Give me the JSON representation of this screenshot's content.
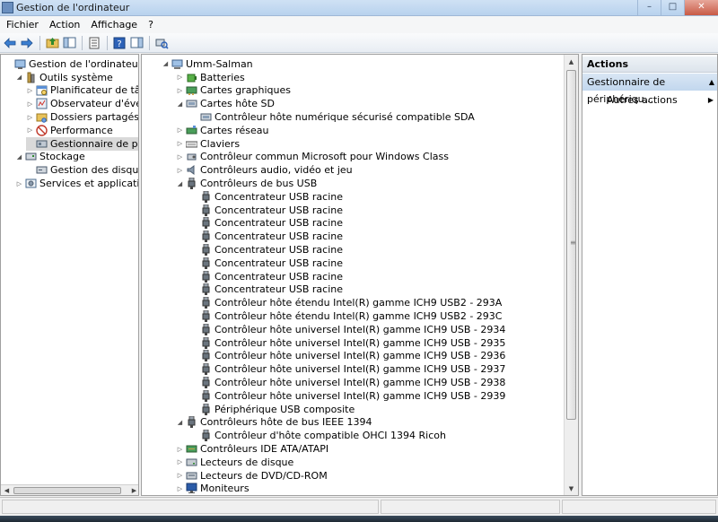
{
  "window": {
    "title": "Gestion de l'ordinateur"
  },
  "menubar": {
    "items": [
      "Fichier",
      "Action",
      "Affichage",
      "?"
    ]
  },
  "left_tree": [
    {
      "label": "Gestion de l'ordinateur (local)",
      "level": 0,
      "expander": "",
      "icon": "computer-management-icon"
    },
    {
      "label": "Outils système",
      "level": 1,
      "expander": "open",
      "icon": "tools-icon"
    },
    {
      "label": "Planificateur de tâches",
      "level": 2,
      "expander": "closed",
      "icon": "task-scheduler-icon"
    },
    {
      "label": "Observateur d'événements",
      "level": 2,
      "expander": "closed",
      "icon": "event-viewer-icon"
    },
    {
      "label": "Dossiers partagés",
      "level": 2,
      "expander": "closed",
      "icon": "shared-folder-icon"
    },
    {
      "label": "Performance",
      "level": 2,
      "expander": "closed",
      "icon": "performance-icon"
    },
    {
      "label": "Gestionnaire de périphériques",
      "level": 2,
      "expander": "",
      "icon": "device-manager-icon",
      "selected": true
    },
    {
      "label": "Stockage",
      "level": 1,
      "expander": "open",
      "icon": "storage-icon"
    },
    {
      "label": "Gestion des disques",
      "level": 2,
      "expander": "",
      "icon": "disk-management-icon"
    },
    {
      "label": "Services et applications",
      "level": 1,
      "expander": "closed",
      "icon": "services-icon"
    }
  ],
  "device_tree": [
    {
      "label": "Umm-Salman",
      "level": 0,
      "expander": "open",
      "icon": "computer-icon"
    },
    {
      "label": "Batteries",
      "level": 1,
      "expander": "closed",
      "icon": "battery-icon"
    },
    {
      "label": "Cartes graphiques",
      "level": 1,
      "expander": "closed",
      "icon": "display-adapter-icon"
    },
    {
      "label": "Cartes hôte SD",
      "level": 1,
      "expander": "open",
      "icon": "sd-host-icon"
    },
    {
      "label": "Contrôleur hôte numérique sécurisé compatible SDA",
      "level": 2,
      "expander": "",
      "icon": "sd-host-icon"
    },
    {
      "label": "Cartes réseau",
      "level": 1,
      "expander": "closed",
      "icon": "network-adapter-icon"
    },
    {
      "label": "Claviers",
      "level": 1,
      "expander": "closed",
      "icon": "keyboard-icon"
    },
    {
      "label": "Contrôleur commun Microsoft pour Windows Class",
      "level": 1,
      "expander": "closed",
      "icon": "controller-icon"
    },
    {
      "label": "Contrôleurs audio, vidéo et jeu",
      "level": 1,
      "expander": "closed",
      "icon": "audio-icon"
    },
    {
      "label": "Contrôleurs de bus USB",
      "level": 1,
      "expander": "open",
      "icon": "usb-icon"
    },
    {
      "label": "Concentrateur USB racine",
      "level": 2,
      "expander": "",
      "icon": "usb-icon"
    },
    {
      "label": "Concentrateur USB racine",
      "level": 2,
      "expander": "",
      "icon": "usb-icon"
    },
    {
      "label": "Concentrateur USB racine",
      "level": 2,
      "expander": "",
      "icon": "usb-icon"
    },
    {
      "label": "Concentrateur USB racine",
      "level": 2,
      "expander": "",
      "icon": "usb-icon"
    },
    {
      "label": "Concentrateur USB racine",
      "level": 2,
      "expander": "",
      "icon": "usb-icon"
    },
    {
      "label": "Concentrateur USB racine",
      "level": 2,
      "expander": "",
      "icon": "usb-icon"
    },
    {
      "label": "Concentrateur USB racine",
      "level": 2,
      "expander": "",
      "icon": "usb-icon"
    },
    {
      "label": "Concentrateur USB racine",
      "level": 2,
      "expander": "",
      "icon": "usb-icon"
    },
    {
      "label": "Contrôleur hôte étendu Intel(R) gamme ICH9 USB2 - 293A",
      "level": 2,
      "expander": "",
      "icon": "usb-icon"
    },
    {
      "label": "Contrôleur hôte étendu Intel(R) gamme ICH9 USB2 - 293C",
      "level": 2,
      "expander": "",
      "icon": "usb-icon"
    },
    {
      "label": "Contrôleur hôte universel Intel(R) gamme ICH9 USB - 2934",
      "level": 2,
      "expander": "",
      "icon": "usb-icon"
    },
    {
      "label": "Contrôleur hôte universel Intel(R) gamme ICH9 USB - 2935",
      "level": 2,
      "expander": "",
      "icon": "usb-icon"
    },
    {
      "label": "Contrôleur hôte universel Intel(R) gamme ICH9 USB - 2936",
      "level": 2,
      "expander": "",
      "icon": "usb-icon"
    },
    {
      "label": "Contrôleur hôte universel Intel(R) gamme ICH9 USB - 2937",
      "level": 2,
      "expander": "",
      "icon": "usb-icon"
    },
    {
      "label": "Contrôleur hôte universel Intel(R) gamme ICH9 USB - 2938",
      "level": 2,
      "expander": "",
      "icon": "usb-icon"
    },
    {
      "label": "Contrôleur hôte universel Intel(R) gamme ICH9 USB - 2939",
      "level": 2,
      "expander": "",
      "icon": "usb-icon"
    },
    {
      "label": "Périphérique USB composite",
      "level": 2,
      "expander": "",
      "icon": "usb-icon"
    },
    {
      "label": "Contrôleurs hôte de bus IEEE 1394",
      "level": 1,
      "expander": "open",
      "icon": "ieee1394-icon"
    },
    {
      "label": "Contrôleur d'hôte compatible OHCI 1394 Ricoh",
      "level": 2,
      "expander": "",
      "icon": "ieee1394-icon"
    },
    {
      "label": "Contrôleurs IDE ATA/ATAPI",
      "level": 1,
      "expander": "closed",
      "icon": "ide-controller-icon"
    },
    {
      "label": "Lecteurs de disque",
      "level": 1,
      "expander": "closed",
      "icon": "disk-drive-icon"
    },
    {
      "label": "Lecteurs de DVD/CD-ROM",
      "level": 1,
      "expander": "closed",
      "icon": "dvd-drive-icon"
    },
    {
      "label": "Moniteurs",
      "level": 1,
      "expander": "closed",
      "icon": "monitor-icon"
    }
  ],
  "actions": {
    "header": "Actions",
    "section": "Gestionnaire de périphériqu...",
    "items": [
      "Autres actions"
    ]
  }
}
